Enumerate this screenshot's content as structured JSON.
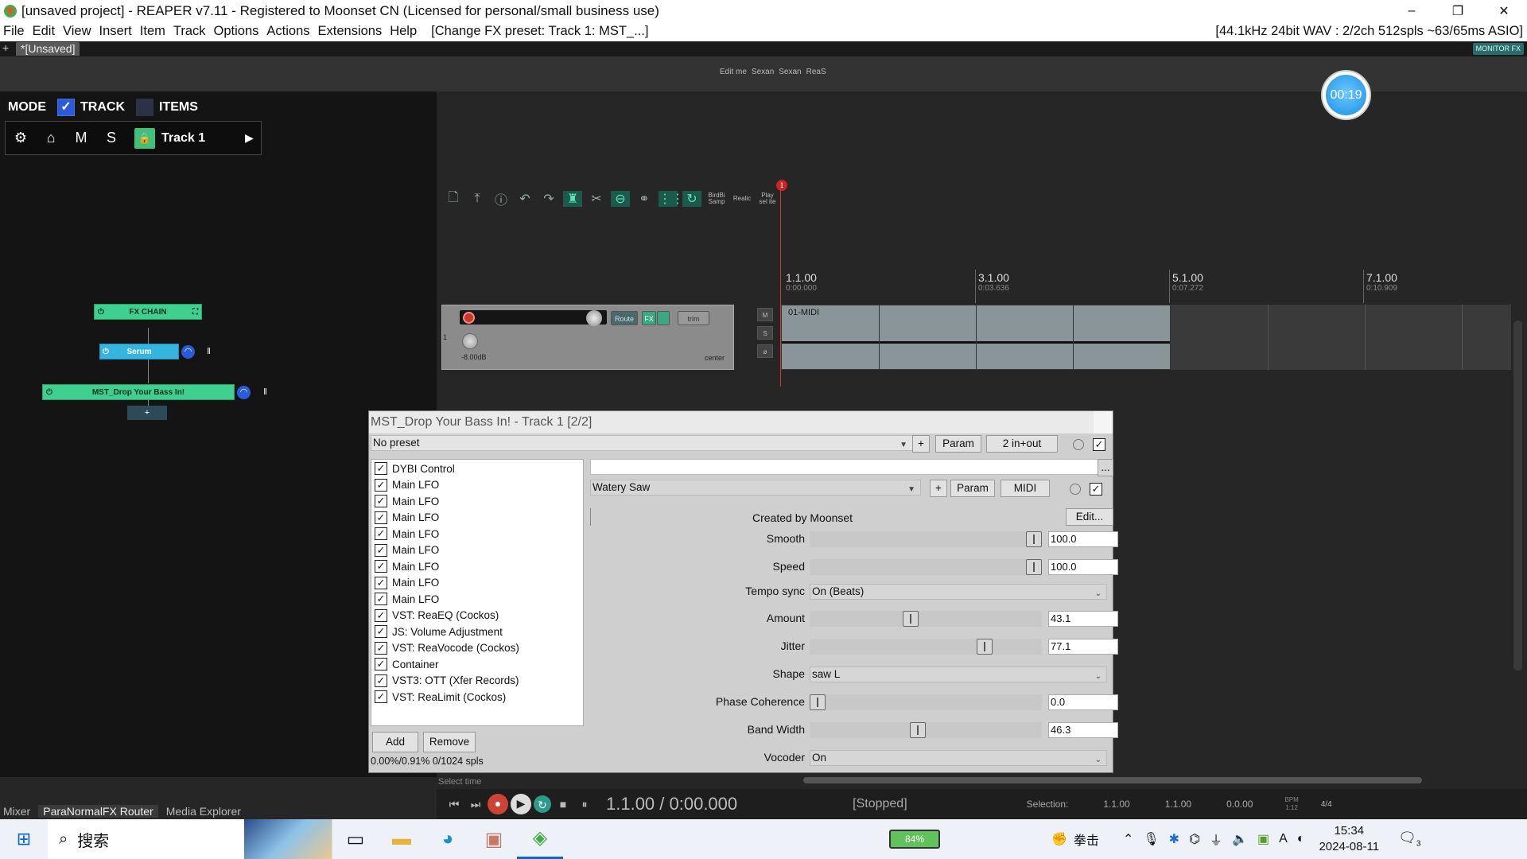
{
  "window": {
    "title": "[unsaved project] - REAPER v7.11 - Registered to Moonset CN (Licensed for personal/small business use)",
    "minimize": "–",
    "restore": "❐",
    "close": "✕"
  },
  "menu": {
    "items": [
      "File",
      "Edit",
      "View",
      "Insert",
      "Item",
      "Track",
      "Options",
      "Actions",
      "Extensions",
      "Help"
    ],
    "fx_preset_info": "[Change FX preset: Track 1: MST_...]",
    "audio_info": "[44.1kHz 24bit WAV : 2/2ch 512spls ~63/65ms ASIO]"
  },
  "tabs": {
    "plus": "+",
    "project": "*[Unsaved]",
    "monitor_fx": "MONITOR FX"
  },
  "top_labels": [
    "Edit me",
    "Sexan",
    "Sexan",
    "ReaS"
  ],
  "timer": "00:19",
  "mode_panel": {
    "mode_label": "MODE",
    "track_checked": "✓",
    "track_label": "TRACK",
    "items_label": "ITEMS",
    "gear": "⚙",
    "home": "⌂",
    "m": "M",
    "s": "S",
    "lock": "🔒",
    "track_name": "Track 1",
    "arrow": "▶"
  },
  "fx_chain_graph": {
    "chain_label": "FX CHAIN",
    "serum_label": "Serum",
    "container_label": "MST_Drop Your Bass In!",
    "add": "+"
  },
  "toolbar": {
    "labels": [
      "BirdBi Samp",
      "Realic",
      "Play sel ite"
    ]
  },
  "ruler": {
    "markers": [
      {
        "bar": "1.1.00",
        "time": "0:00.000"
      },
      {
        "bar": "3.1.00",
        "time": "0:03.636"
      },
      {
        "bar": "5.1.00",
        "time": "0:07.272"
      },
      {
        "bar": "7.1.00",
        "time": "0:10.909"
      }
    ],
    "marker_number": "1"
  },
  "track": {
    "number": "1",
    "route_label": "Route",
    "fx_label": "FX",
    "trim_label": "trim",
    "volume": "-8.00dB",
    "pan": "center",
    "mute": "M",
    "solo": "S",
    "phase": "ø",
    "item_name": "01-MIDI"
  },
  "fx_window": {
    "title": "MST_Drop Your Bass In! - Track 1 [2/2]",
    "preset": "No preset",
    "plus": "+",
    "param": "Param",
    "io": "2 in+out",
    "enabled_check": "✓",
    "fx_list": [
      {
        "label": "DYBI Control",
        "checked": "✓"
      },
      {
        "label": "Main LFO",
        "checked": "✓"
      },
      {
        "label": "Main LFO",
        "checked": "✓"
      },
      {
        "label": "Main LFO",
        "checked": "✓"
      },
      {
        "label": "Main LFO",
        "checked": "✓"
      },
      {
        "label": "Main LFO",
        "checked": "✓"
      },
      {
        "label": "Main LFO",
        "checked": "✓"
      },
      {
        "label": "Main LFO",
        "checked": "✓"
      },
      {
        "label": "Main LFO",
        "checked": "✓"
      },
      {
        "label": "VST: ReaEQ (Cockos)",
        "checked": "✓"
      },
      {
        "label": "JS: Volume Adjustment",
        "checked": "✓"
      },
      {
        "label": "VST: ReaVocode (Cockos)",
        "checked": "✓"
      },
      {
        "label": "Container",
        "checked": "✓"
      },
      {
        "label": "VST3: OTT (Xfer Records)",
        "checked": "✓"
      },
      {
        "label": "VST: ReaLimit (Cockos)",
        "checked": "✓"
      }
    ],
    "add_button": "Add",
    "remove_button": "Remove",
    "cpu": "0.00%/0.91% 0/1024 spls",
    "ellipsis": "...",
    "sub_preset": "Watery Saw",
    "sub_param": "Param",
    "sub_midi": "MIDI",
    "created_by": "Created by Moonset",
    "edit_button": "Edit...",
    "params": [
      {
        "label": "Smooth",
        "value": "100.0",
        "level": 1.0
      },
      {
        "label": "Speed",
        "value": "100.0",
        "level": 1.0
      },
      {
        "label": "Tempo sync",
        "combo": "On (Beats)"
      },
      {
        "label": "Amount",
        "value": "43.1",
        "level": 0.431
      },
      {
        "label": "Jitter",
        "value": "77.1",
        "level": 0.771
      },
      {
        "label": "Shape",
        "combo": "saw L"
      },
      {
        "label": "Phase Coherence",
        "value": "0.0",
        "level": 0.0
      },
      {
        "label": "Band Width",
        "value": "46.3",
        "level": 0.463
      },
      {
        "label": "Vocoder",
        "combo": "On"
      }
    ]
  },
  "transport": {
    "select_time": "Select time",
    "position": "1.1.00 / 0:00.000",
    "status": "[Stopped]",
    "selection_label": "Selection:",
    "sel_start": "1.1.00",
    "sel_end": "1.1.00",
    "sel_len": "0.0.00",
    "bpm_label": "BPM",
    "bpm": "1:12",
    "time_sig": "4/4"
  },
  "dock_tabs": [
    "Mixer",
    "ParaNormalFX Router",
    "Media Explorer"
  ],
  "taskbar": {
    "search_label": "搜索",
    "battery": "84%",
    "game_label": "拳击",
    "time": "15:34",
    "date": "2024-08-11",
    "notif_count": "3"
  }
}
